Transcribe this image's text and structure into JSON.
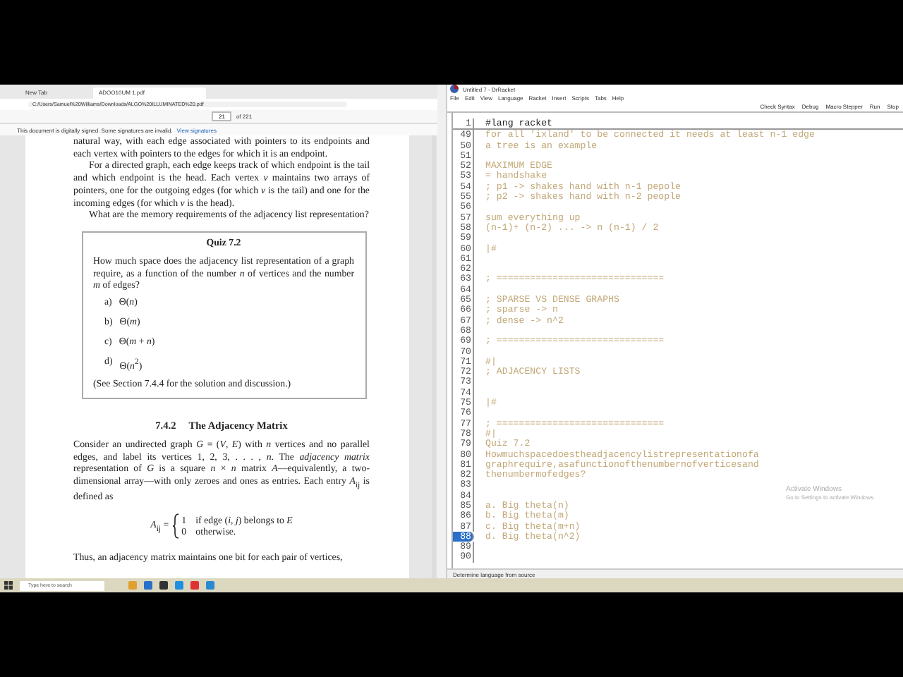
{
  "browser": {
    "tabs": [
      {
        "title": "New Tab",
        "selected": false
      },
      {
        "title": "ADOO10UM 1.pdf",
        "selected": true
      }
    ],
    "address": "C:/Users/Samuel%20Williams/Downloads/ALGO%20ILLUMINATED%20.pdf",
    "pdf_toolbar": {
      "page": "21",
      "page_count": "of 221"
    },
    "signature_bar": {
      "message": "This document is digitally signed. Some signatures are invalid.",
      "link": "View signatures"
    }
  },
  "pdf": {
    "paragraphs_top": [
      {
        "indent": false,
        "text": "natural way, with each edge associated with pointers to its endpoints and each vertex with pointers to the edges for which it is an endpoint."
      },
      {
        "indent": true,
        "text": "For a directed graph, each edge keeps track of which endpoint is the tail and which endpoint is the head. Each vertex *v* maintains two arrays of pointers, one for the outgoing edges (for which *v* is the tail) and one for the incoming edges (for which *v* is the head)."
      },
      {
        "indent": true,
        "text": "What are the memory requirements of the adjacency list representation?"
      }
    ],
    "quiz": {
      "title": "Quiz 7.2",
      "question": "How much space does the adjacency list representation of a graph require, as a function of the number *n* of vertices and the number *m* of edges?",
      "options": [
        {
          "label": "a)",
          "text": "Θ(*n*)"
        },
        {
          "label": "b)",
          "text": "Θ(*m*)"
        },
        {
          "label": "c)",
          "text": "Θ(*m* + *n*)"
        },
        {
          "label": "d)",
          "text": "Θ(*n*$^{2}$)"
        }
      ],
      "footer": "(See Section 7.4.4 for the solution and discussion.)"
    },
    "section": {
      "number": "7.4.2",
      "title": "The Adjacency Matrix"
    },
    "paragraph_matrix": "Consider an undirected graph *G* = (*V*, *E*) with *n* vertices and no parallel edges, and label its vertices 1, 2, 3, . . . , *n*. The *adjacency matrix* representation of *G* is a square *n* × *n* matrix *A*—equivalently, a two-dimensional array—with only zeroes and ones as entries. Each entry *A*$_{ij}$ is defined as",
    "equation": {
      "lhs": "*A*$_{ij}$ =",
      "cases": [
        {
          "value": "1",
          "condition": "if edge (*i*, *j*) belongs to *E*"
        },
        {
          "value": "0",
          "condition": "otherwise."
        }
      ]
    },
    "paragraph_bottom": "Thus, an adjacency matrix maintains one bit for each pair of vertices,"
  },
  "drracket": {
    "title": "Untitled 7 - DrRacket",
    "menu": [
      "File",
      "Edit",
      "View",
      "Language",
      "Racket",
      "Insert",
      "Scripts",
      "Tabs",
      "Help"
    ],
    "toolbar": [
      "Check Syntax",
      "Debug",
      "Macro Stepper",
      "Run",
      "Stop"
    ],
    "lines": [
      {
        "number": "1",
        "text": "#lang racket",
        "kind": "code",
        "highlighted": false
      },
      {
        "number": "49",
        "text": "for all 'ixland' to be connected it needs at least n-1 edge",
        "kind": "comment",
        "highlighted": false
      },
      {
        "number": "50",
        "text": "a tree is an example",
        "kind": "comment",
        "highlighted": false
      },
      {
        "number": "51",
        "kind": "comment",
        "highlighted": false
      },
      {
        "number": "52",
        "text": "MAXIMUM EDGE",
        "kind": "comment",
        "highlighted": false
      },
      {
        "number": "53",
        "text": "= handshake",
        "kind": "comment",
        "highlighted": false
      },
      {
        "number": "54",
        "text": "; p1 -> shakes hand with n-1 pepole",
        "kind": "comment",
        "highlighted": false
      },
      {
        "number": "55",
        "text": "; p2 -> shakes hand with n-2 people",
        "kind": "comment",
        "highlighted": false
      },
      {
        "number": "56",
        "kind": "comment",
        "highlighted": false
      },
      {
        "number": "57",
        "text": "sum everything up",
        "kind": "comment",
        "highlighted": false
      },
      {
        "number": "58",
        "text": "(n-1)+ (n-2) ... -> n (n-1) / 2",
        "kind": "comment",
        "highlighted": false
      },
      {
        "number": "59",
        "kind": "comment",
        "highlighted": false
      },
      {
        "number": "60",
        "text": "|#",
        "kind": "comment",
        "highlighted": false
      },
      {
        "number": "61",
        "kind": "comment",
        "highlighted": false
      },
      {
        "number": "62",
        "kind": "comment",
        "highlighted": false
      },
      {
        "number": "63",
        "text": "; ==============================",
        "kind": "comment",
        "highlighted": false
      },
      {
        "number": "64",
        "kind": "comment",
        "highlighted": false
      },
      {
        "number": "65",
        "text": "; SPARSE VS DENSE GRAPHS",
        "kind": "comment",
        "highlighted": false
      },
      {
        "number": "66",
        "text": "; sparse -> n",
        "kind": "comment",
        "highlighted": false
      },
      {
        "number": "67",
        "text": "; dense -> n^2",
        "kind": "comment",
        "highlighted": false
      },
      {
        "number": "68",
        "kind": "comment",
        "highlighted": false
      },
      {
        "number": "69",
        "text": "; ==============================",
        "kind": "comment",
        "highlighted": false
      },
      {
        "number": "70",
        "kind": "comment",
        "highlighted": false
      },
      {
        "number": "71",
        "text": "#|",
        "kind": "comment",
        "highlighted": false
      },
      {
        "number": "72",
        "text": "; ADJACENCY LISTS",
        "kind": "comment",
        "highlighted": false
      },
      {
        "number": "73",
        "kind": "comment",
        "highlighted": false
      },
      {
        "number": "74",
        "kind": "comment",
        "highlighted": false
      },
      {
        "number": "75",
        "text": "|#",
        "kind": "comment",
        "highlighted": false
      },
      {
        "number": "76",
        "kind": "comment",
        "highlighted": false
      },
      {
        "number": "77",
        "text": "; ==============================",
        "kind": "comment",
        "highlighted": false
      },
      {
        "number": "78",
        "text": "#|",
        "kind": "comment",
        "highlighted": false
      },
      {
        "number": "79",
        "text": "Quiz 7.2",
        "kind": "comment",
        "highlighted": false
      },
      {
        "number": "80",
        "text": "Howmuchspacedoestheadjacencylistrepresentationofa",
        "kind": "comment",
        "highlighted": false
      },
      {
        "number": "81",
        "text": "graphrequire,asafunctionofthenumbernofverticesand",
        "kind": "comment",
        "highlighted": false
      },
      {
        "number": "82",
        "text": "thenumbermofedges?",
        "kind": "comment",
        "highlighted": false
      },
      {
        "number": "83",
        "kind": "comment",
        "highlighted": false
      },
      {
        "number": "84",
        "kind": "comment",
        "highlighted": false
      },
      {
        "number": "85",
        "text": "a. Big theta(n)",
        "kind": "comment",
        "highlighted": false
      },
      {
        "number": "86",
        "text": "b. Big theta(m)",
        "kind": "comment",
        "highlighted": false
      },
      {
        "number": "87",
        "text": "c. Big theta(m+n)",
        "kind": "comment",
        "highlighted": false
      },
      {
        "number": "88",
        "text": "d. Big theta(n^2)",
        "kind": "comment",
        "highlighted": true
      },
      {
        "number": "89",
        "kind": "comment",
        "highlighted": false
      },
      {
        "number": "90",
        "kind": "comment",
        "highlighted": false
      }
    ],
    "status": "Determine language from source",
    "activation": {
      "title": "Activate Windows",
      "hint": "Go to Settings to activate Windows."
    }
  },
  "taskbar": {
    "search_placeholder": "Type here to search"
  }
}
